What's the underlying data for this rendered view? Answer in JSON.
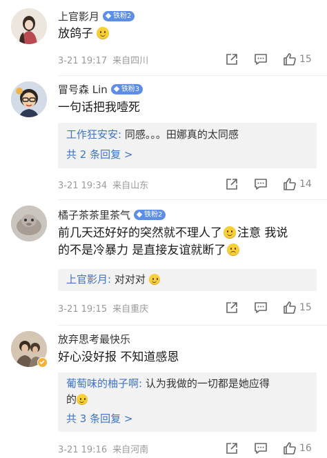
{
  "comments": [
    {
      "name": "上官影月",
      "badge": "铁粉2",
      "text": "放鸽子",
      "date": "3-21 19:17",
      "source": "来自四川",
      "likes": "15"
    },
    {
      "name": "冒号森 Lin",
      "badge": "铁粉3",
      "text": "一句话把我噎死",
      "reply_author": "工作狂安安:",
      "reply_text": " 同感。。。田娜真的太同感",
      "reply_more": "共 2 条回复 >",
      "date": "3-21 19:34",
      "source": "来自山东",
      "likes": "14"
    },
    {
      "name": "橘子茶茶里茶气",
      "badge": "铁粉2",
      "text_a": "前几天还好好的突然就不理人了",
      "text_b": "注意 我说",
      "text_c": "的不是冷暴力 是直接友谊就断了",
      "reply_author": "上官影月:",
      "reply_text": " 对对对",
      "date": "3-21 19:15",
      "source": "来自重庆",
      "likes": "15"
    },
    {
      "name": "放弃思考最快乐",
      "text": "好心没好报 不知道感恩",
      "reply_author": "葡萄味的柚子啊:",
      "reply_text_a": " 认为我做的一切都是她应得",
      "reply_text_b": "的",
      "reply_more": "共 3 条回复 >",
      "date": "3-21 19:16",
      "source": "来自河南",
      "likes": "16"
    }
  ],
  "colors": {
    "badge": "#5d8ee6",
    "reply_author": "#3f73c5",
    "meta": "#999999",
    "reply_bg": "#f2f2f2"
  },
  "icons": [
    "share-icon",
    "comment-icon",
    "like-icon",
    "smile-emoji",
    "sweat-emoji",
    "cry-emoji",
    "verified-icon"
  ]
}
